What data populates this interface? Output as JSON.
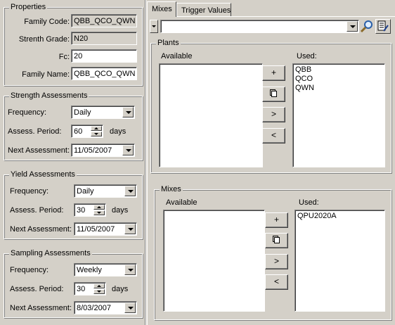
{
  "properties": {
    "title": "Properties",
    "family_code_label": "Family Code:",
    "family_code": "QBB_QCO_QWN",
    "strength_grade_label": "Strenth Grade:",
    "strength_grade": "N20",
    "fc_label": "Fc:",
    "fc": "20",
    "family_name_label": "Family Name:",
    "family_name": "QBB_QCO_QWN"
  },
  "strength": {
    "title": "Strength Assessments",
    "frequency_label": "Frequency:",
    "frequency": "Daily",
    "period_label": "Assess. Period:",
    "period": "60",
    "period_unit": "days",
    "next_label": "Next Assessment:",
    "next": "11/05/2007"
  },
  "yield": {
    "title": "Yield Assessments",
    "frequency_label": "Frequency:",
    "frequency": "Daily",
    "period_label": "Assess. Period:",
    "period": "30",
    "period_unit": "days",
    "next_label": "Next Assessment:",
    "next": "11/05/2007"
  },
  "sampling": {
    "title": "Sampling Assessments",
    "frequency_label": "Frequency:",
    "frequency": "Weekly",
    "period_label": "Assess. Period:",
    "period": "30",
    "period_unit": "days",
    "next_label": "Next Assessment:",
    "next": "8/03/2007"
  },
  "tabs": [
    {
      "label": "Mixes",
      "active": true
    },
    {
      "label": "Trigger Values",
      "active": false
    }
  ],
  "toolbar": {
    "search_value": "",
    "icons": [
      "search-icon",
      "edit-list-icon"
    ]
  },
  "plants": {
    "title": "Plants",
    "available_label": "Available",
    "used_label": "Used:",
    "available": [],
    "used": [
      "QBB",
      "QCO",
      "QWN"
    ],
    "buttons": {
      "add": "+",
      "copy": "copy-icon",
      "move_right": ">",
      "move_left": "<"
    }
  },
  "mixes": {
    "title": "Mixes",
    "available_label": "Available",
    "used_label": "Used:",
    "available": [],
    "used": [
      "QPU2020A"
    ],
    "buttons": {
      "add": "+",
      "copy": "copy-icon",
      "move_right": ">",
      "move_left": "<"
    }
  }
}
